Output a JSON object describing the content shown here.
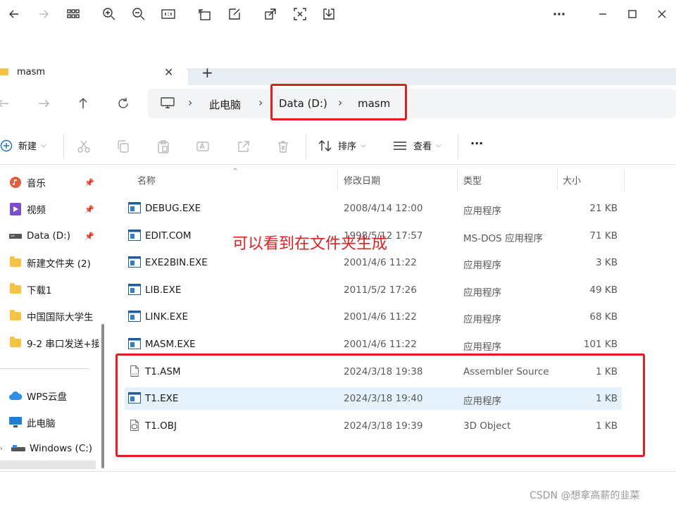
{
  "tab": {
    "label": "masm",
    "close": "✕",
    "add": "+"
  },
  "breadcrumb": [
    "此电脑",
    "Data (D:)",
    "masm"
  ],
  "breadcrumb_sep": "›",
  "commands": {
    "new": "新建",
    "sort": "排序",
    "view": "查看",
    "more": "···"
  },
  "sidebar": {
    "items": [
      {
        "label": "音乐",
        "icon": "music-icon",
        "pinned": true
      },
      {
        "label": "视频",
        "icon": "video-icon",
        "pinned": true
      },
      {
        "label": "Data (D:)",
        "icon": "drive-icon",
        "pinned": true
      },
      {
        "label": "新建文件夹 (2)",
        "icon": "folder-icon",
        "pinned": false
      },
      {
        "label": "下载1",
        "icon": "folder-icon",
        "pinned": false
      },
      {
        "label": "中国国际大学生",
        "icon": "folder-icon",
        "pinned": false
      },
      {
        "label": "9-2 串口发送+接",
        "icon": "folder-icon",
        "pinned": false
      },
      {
        "label": "WPS云盘",
        "icon": "cloud-icon",
        "pinned": false
      },
      {
        "label": "此电脑",
        "icon": "computer-icon",
        "pinned": false
      },
      {
        "label": "Windows (C:)",
        "icon": "drive-icon",
        "pinned": false
      }
    ]
  },
  "columns": {
    "name": "名称",
    "date": "修改日期",
    "type": "类型",
    "size": "大小"
  },
  "files": [
    {
      "name": "DEBUG.EXE",
      "date": "2008/4/14 12:00",
      "type": "应用程序",
      "size": "21 KB",
      "icon": "exe-icon"
    },
    {
      "name": "EDIT.COM",
      "date": "1998/5/12 17:57",
      "type": "MS-DOS 应用程序",
      "size": "71 KB",
      "icon": "exe-icon"
    },
    {
      "name": "EXE2BIN.EXE",
      "date": "2001/4/6 11:22",
      "type": "应用程序",
      "size": "3 KB",
      "icon": "exe-icon"
    },
    {
      "name": "LIB.EXE",
      "date": "2011/5/2 17:26",
      "type": "应用程序",
      "size": "49 KB",
      "icon": "exe-icon"
    },
    {
      "name": "LINK.EXE",
      "date": "2001/4/6 11:22",
      "type": "应用程序",
      "size": "68 KB",
      "icon": "exe-icon"
    },
    {
      "name": "MASM.EXE",
      "date": "2001/4/6 11:22",
      "type": "应用程序",
      "size": "101 KB",
      "icon": "exe-icon"
    },
    {
      "name": "T1.ASM",
      "date": "2024/3/18 19:38",
      "type": "Assembler Source",
      "size": "1 KB",
      "icon": "asm-file-icon"
    },
    {
      "name": "T1.EXE",
      "date": "2024/3/18 19:40",
      "type": "应用程序",
      "size": "1 KB",
      "icon": "exe-icon"
    },
    {
      "name": "T1.OBJ",
      "date": "2024/3/18 19:39",
      "type": "3D Object",
      "size": "1 KB",
      "icon": "obj-file-icon"
    }
  ],
  "annotation": "可以看到在文件夹生成",
  "watermark": "CSDN @想拿高薪的韭菜",
  "colors": {
    "annotation": "#e02020",
    "selection": "#e5f1fb",
    "folder": "#f6c344"
  }
}
